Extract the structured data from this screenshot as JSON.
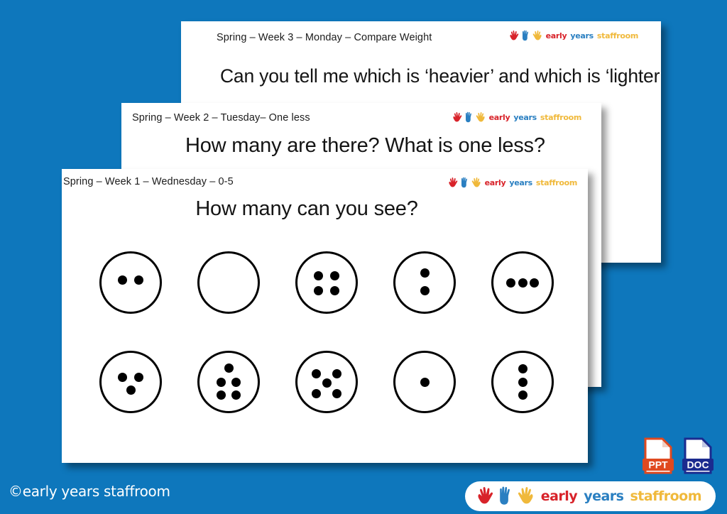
{
  "page": {
    "background_color": "#0e77bc",
    "copyright": "©early years staffroom"
  },
  "logo": {
    "word_early": "early",
    "word_years": "years",
    "word_staffroom": "staffroom",
    "hand_colors": [
      "#d8232a",
      "#2a7fc1",
      "#f0b93b"
    ]
  },
  "slides": {
    "back": {
      "subtitle": "Spring – Week 3 – Monday – Compare Weight",
      "title": "Can you tell me which is ‘heavier’ and which is ‘lighter’?"
    },
    "mid": {
      "subtitle": "Spring – Week 2 – Tuesday– One less",
      "title": "How many are there? What is one less?"
    },
    "front": {
      "subtitle": "Spring – Week 1 – Wednesday – 0-5",
      "title": "How many can you see?"
    }
  },
  "chart_data": {
    "type": "table",
    "title": "How many can you see?",
    "description": "Ten circles each containing a number of black dots arranged in a pattern",
    "rows": [
      [
        {
          "count": 2,
          "pattern": "horizontal-pair"
        },
        {
          "count": 0,
          "pattern": "empty"
        },
        {
          "count": 4,
          "pattern": "square"
        },
        {
          "count": 2,
          "pattern": "vertical-pair"
        },
        {
          "count": 3,
          "pattern": "horizontal-row"
        }
      ],
      [
        {
          "count": 3,
          "pattern": "triangle"
        },
        {
          "count": 5,
          "pattern": "one-two-two"
        },
        {
          "count": 5,
          "pattern": "dice-five"
        },
        {
          "count": 1,
          "pattern": "center"
        },
        {
          "count": 3,
          "pattern": "vertical-column"
        }
      ]
    ]
  },
  "file_icons": [
    {
      "label": "PPT",
      "color": "#e0491f"
    },
    {
      "label": "DOC",
      "color": "#1b2b8f"
    }
  ]
}
